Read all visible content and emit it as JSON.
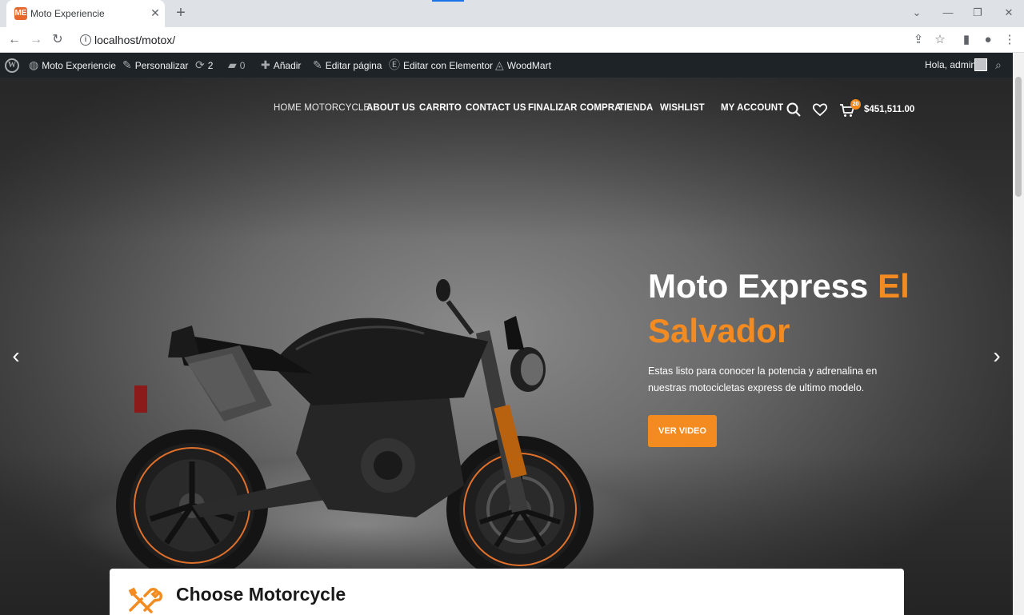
{
  "browser": {
    "tab_title": "Moto Experiencie",
    "favicon_text": "ME",
    "url": "localhost/motox/",
    "accent_color": "#1a73e8"
  },
  "adminbar": {
    "site_name": "Moto Experiencie",
    "customize": "Personalizar",
    "updates_count": "2",
    "comments_count": "0",
    "add_new": "Añadir",
    "edit_page": "Editar página",
    "edit_elementor": "Editar con Elementor",
    "woodmart": "WoodMart",
    "greeting": "Hola, admin"
  },
  "nav": {
    "items": [
      {
        "label": "HOME MOTORCYCLE"
      },
      {
        "label": "ABOUT US"
      },
      {
        "label": "CARRITO"
      },
      {
        "label": "CONTACT US"
      },
      {
        "label": "FINALIZAR COMPRA"
      },
      {
        "label": "TIENDA"
      },
      {
        "label": "WISHLIST"
      },
      {
        "label": "MY ACCOUNT"
      }
    ],
    "cart_count": "20",
    "cart_total": "$451,511.00"
  },
  "hero": {
    "title_white": "Moto Express ",
    "title_accent": "El Salvador",
    "text": "Estas listo para conocer la potencia y adrenalina en nuestras motocicletas express de ultimo modelo.",
    "button_label": "VER VIDEO",
    "accent_color": "#f38b21"
  },
  "section": {
    "title": "Choose Motorcycle"
  }
}
